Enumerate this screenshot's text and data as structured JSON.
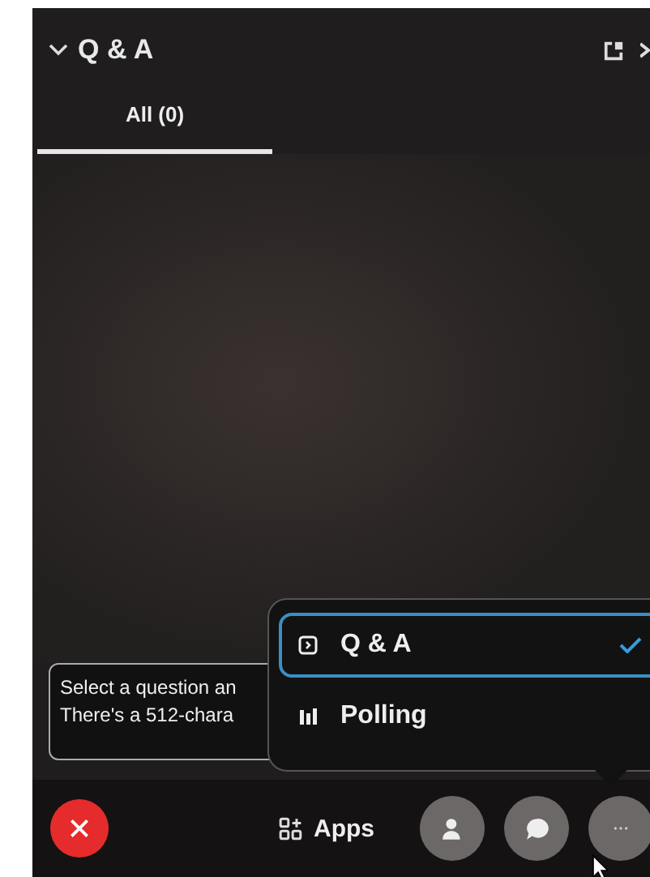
{
  "panel": {
    "title": "Q & A"
  },
  "tabs": [
    {
      "label": "All (0)",
      "selected": true
    }
  ],
  "question_field": {
    "placeholder_lines": [
      "Select a question an",
      "There's a 512-chara"
    ]
  },
  "menu": {
    "items": [
      {
        "label": "Q & A",
        "kind": "qa",
        "selected": true
      },
      {
        "label": "Polling",
        "kind": "polling",
        "selected": false
      }
    ]
  },
  "toolbar": {
    "apps_label": "Apps"
  }
}
